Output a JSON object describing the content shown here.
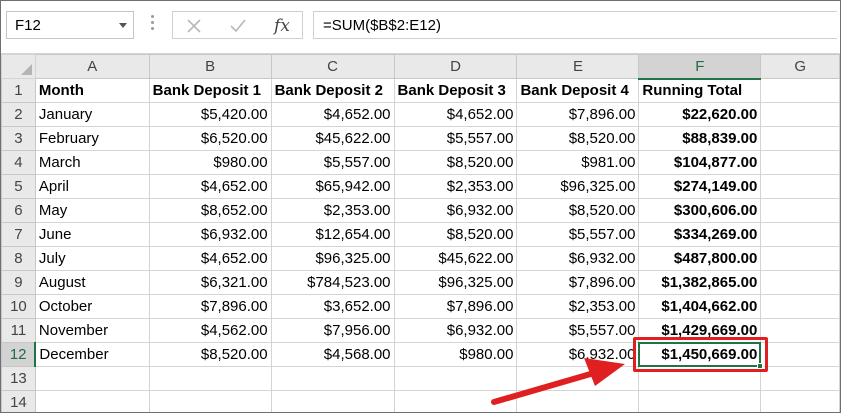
{
  "name_box": {
    "value": "F12"
  },
  "formula_bar": {
    "cancel_glyph": "✕",
    "enter_glyph": "✓",
    "fx_label": "fx",
    "formula": "=SUM($B$2:E12)"
  },
  "columns": [
    "A",
    "B",
    "C",
    "D",
    "E",
    "F",
    "G"
  ],
  "selected_column": "F",
  "selected_row": "12",
  "rows": [
    {
      "n": "1",
      "cells": [
        "Month",
        "Bank Deposit 1",
        "Bank Deposit 2",
        "Bank Deposit 3",
        "Bank Deposit 4",
        "Running Total",
        ""
      ]
    },
    {
      "n": "2",
      "cells": [
        "January",
        "$5,420.00",
        "$4,652.00",
        "$4,652.00",
        "$7,896.00",
        "$22,620.00",
        ""
      ]
    },
    {
      "n": "3",
      "cells": [
        "February",
        "$6,520.00",
        "$45,622.00",
        "$5,557.00",
        "$8,520.00",
        "$88,839.00",
        ""
      ]
    },
    {
      "n": "4",
      "cells": [
        "March",
        "$980.00",
        "$5,557.00",
        "$8,520.00",
        "$981.00",
        "$104,877.00",
        ""
      ]
    },
    {
      "n": "5",
      "cells": [
        "April",
        "$4,652.00",
        "$65,942.00",
        "$2,353.00",
        "$96,325.00",
        "$274,149.00",
        ""
      ]
    },
    {
      "n": "6",
      "cells": [
        "May",
        "$8,652.00",
        "$2,353.00",
        "$6,932.00",
        "$8,520.00",
        "$300,606.00",
        ""
      ]
    },
    {
      "n": "7",
      "cells": [
        "June",
        "$6,932.00",
        "$12,654.00",
        "$8,520.00",
        "$5,557.00",
        "$334,269.00",
        ""
      ]
    },
    {
      "n": "8",
      "cells": [
        "July",
        "$4,652.00",
        "$96,325.00",
        "$45,622.00",
        "$6,932.00",
        "$487,800.00",
        ""
      ]
    },
    {
      "n": "9",
      "cells": [
        "August",
        "$6,321.00",
        "$784,523.00",
        "$96,325.00",
        "$7,896.00",
        "$1,382,865.00",
        ""
      ]
    },
    {
      "n": "10",
      "cells": [
        "October",
        "$7,896.00",
        "$3,652.00",
        "$7,896.00",
        "$2,353.00",
        "$1,404,662.00",
        ""
      ]
    },
    {
      "n": "11",
      "cells": [
        "November",
        "$4,562.00",
        "$7,956.00",
        "$6,932.00",
        "$5,557.00",
        "$1,429,669.00",
        ""
      ]
    },
    {
      "n": "12",
      "cells": [
        "December",
        "$8,520.00",
        "$4,568.00",
        "$980.00",
        "$6,932.00",
        "$1,450,669.00",
        ""
      ]
    },
    {
      "n": "13",
      "cells": [
        "",
        "",
        "",
        "",
        "",
        "",
        ""
      ]
    },
    {
      "n": "14",
      "cells": [
        "",
        "",
        "",
        "",
        "",
        "",
        ""
      ]
    }
  ],
  "colors": {
    "selection_green": "#217346",
    "annotation_red": "#e02020",
    "header_gray": "#e9e9e9"
  }
}
